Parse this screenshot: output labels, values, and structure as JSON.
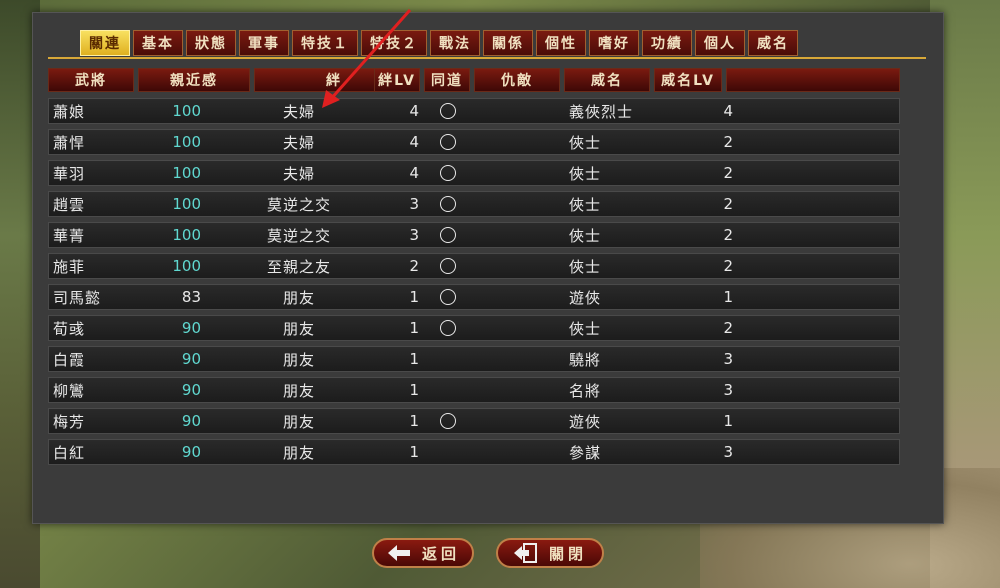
{
  "tabs": [
    {
      "label": "關連",
      "active": true
    },
    {
      "label": "基本",
      "active": false
    },
    {
      "label": "狀態",
      "active": false
    },
    {
      "label": "軍事",
      "active": false
    },
    {
      "label": "特技１",
      "active": false
    },
    {
      "label": "特技２",
      "active": false
    },
    {
      "label": "戰法",
      "active": false
    },
    {
      "label": "關係",
      "active": false
    },
    {
      "label": "個性",
      "active": false
    },
    {
      "label": "嗜好",
      "active": false
    },
    {
      "label": "功績",
      "active": false
    },
    {
      "label": "個人",
      "active": false
    },
    {
      "label": "威名",
      "active": false
    }
  ],
  "table": {
    "headers": {
      "general": "武將",
      "affinity": "親近感",
      "relation": "絆",
      "relation_lv": "絆LV",
      "accompany": "同道",
      "enemy": "仇敵",
      "fame": "威名",
      "fame_lv": "威名LV"
    },
    "rows": [
      {
        "name": "蕭娘",
        "affinity": "100",
        "relation": "夫婦",
        "lv": "4",
        "accompany": true,
        "fame": "義俠烈士",
        "fame_lv": "4"
      },
      {
        "name": "蕭悍",
        "affinity": "100",
        "relation": "夫婦",
        "lv": "4",
        "accompany": true,
        "fame": "俠士",
        "fame_lv": "2"
      },
      {
        "name": "華羽",
        "affinity": "100",
        "relation": "夫婦",
        "lv": "4",
        "accompany": true,
        "fame": "俠士",
        "fame_lv": "2"
      },
      {
        "name": "趙雲",
        "affinity": "100",
        "relation": "莫逆之交",
        "lv": "3",
        "accompany": true,
        "fame": "俠士",
        "fame_lv": "2"
      },
      {
        "name": "華菁",
        "affinity": "100",
        "relation": "莫逆之交",
        "lv": "3",
        "accompany": true,
        "fame": "俠士",
        "fame_lv": "2"
      },
      {
        "name": "施菲",
        "affinity": "100",
        "relation": "至親之友",
        "lv": "2",
        "accompany": true,
        "fame": "俠士",
        "fame_lv": "2"
      },
      {
        "name": "司馬懿",
        "affinity": "83",
        "relation": "朋友",
        "lv": "1",
        "accompany": true,
        "fame": "遊俠",
        "fame_lv": "1"
      },
      {
        "name": "荀彧",
        "affinity": "90",
        "relation": "朋友",
        "lv": "1",
        "accompany": true,
        "fame": "俠士",
        "fame_lv": "2"
      },
      {
        "name": "白霞",
        "affinity": "90",
        "relation": "朋友",
        "lv": "1",
        "accompany": false,
        "fame": "驍將",
        "fame_lv": "3"
      },
      {
        "name": "柳鸞",
        "affinity": "90",
        "relation": "朋友",
        "lv": "1",
        "accompany": false,
        "fame": "名將",
        "fame_lv": "3"
      },
      {
        "name": "梅芳",
        "affinity": "90",
        "relation": "朋友",
        "lv": "1",
        "accompany": true,
        "fame": "遊俠",
        "fame_lv": "1"
      },
      {
        "name": "白紅",
        "affinity": "90",
        "relation": "朋友",
        "lv": "1",
        "accompany": false,
        "fame": "參謀",
        "fame_lv": "3"
      }
    ]
  },
  "buttons": {
    "back_label": "返回",
    "close_label": "關閉",
    "back_icon": "arrow-left-icon",
    "close_icon": "exit-icon"
  },
  "colors": {
    "active_tab": "#f0c840",
    "affinity_max": "#60d8d0",
    "annotation_arrow": "#e02020"
  }
}
